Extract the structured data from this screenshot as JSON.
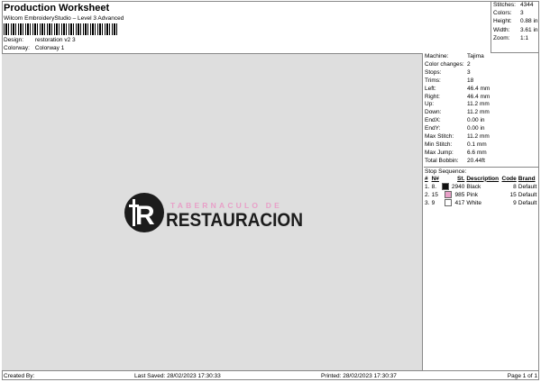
{
  "header": {
    "title": "Production Worksheet",
    "subtitle": "Wilcom EmbroideryStudio – Level 3 Advanced"
  },
  "design": {
    "label": "Design:",
    "value": "restoration v2 3"
  },
  "colorway": {
    "label": "Colorway:",
    "value": "Colorway 1"
  },
  "summary": [
    {
      "k": "Stitches:",
      "v": "4344"
    },
    {
      "k": "Colors:",
      "v": "3"
    },
    {
      "k": "Height:",
      "v": "0.88 in"
    },
    {
      "k": "Width:",
      "v": "3.61 in"
    },
    {
      "k": "Zoom:",
      "v": "1:1"
    }
  ],
  "details": [
    {
      "k": "Machine:",
      "v": "Tajima"
    },
    {
      "k": "Color changes:",
      "v": "2"
    },
    {
      "k": "Stops:",
      "v": "3"
    },
    {
      "k": "Trims:",
      "v": "18"
    },
    {
      "k": "Left:",
      "v": "46.4 mm"
    },
    {
      "k": "Right:",
      "v": "46.4 mm"
    },
    {
      "k": "Up:",
      "v": "11.2 mm"
    },
    {
      "k": "Down:",
      "v": "11.2 mm"
    },
    {
      "k": "EndX:",
      "v": "0.00 in"
    },
    {
      "k": "EndY:",
      "v": "0.00 in"
    },
    {
      "k": "Max Stitch:",
      "v": "11.2 mm"
    },
    {
      "k": "Min Stitch:",
      "v": "0.1 mm"
    },
    {
      "k": "Max Jump:",
      "v": "6.6 mm"
    },
    {
      "k": "Total Bobbin:",
      "v": "20.44ft"
    }
  ],
  "stop_sequence": {
    "title": "Stop Sequence:",
    "headers": [
      "#",
      "N#",
      "St.",
      "Description",
      "Code",
      "Brand"
    ],
    "rows": [
      {
        "n": "1.",
        "needle": "8.",
        "color": "#111111",
        "st": "2940",
        "desc": "Black",
        "code": "8",
        "brand": "Default"
      },
      {
        "n": "2.",
        "needle": "15",
        "color": "#e8a0c8",
        "st": "985",
        "desc": "Pink",
        "code": "15",
        "brand": "Default"
      },
      {
        "n": "3.",
        "needle": "9",
        "color": "#ffffff",
        "st": "417",
        "desc": "White",
        "code": "9",
        "brand": "Default"
      }
    ]
  },
  "logo": {
    "top_text": "TABERNACULO DE",
    "main_text": "RESTAURACION",
    "mark_text": "R",
    "pink": "#e8a0c8",
    "dark": "#1c1c1c"
  },
  "footer": {
    "created": "Created By:",
    "last_saved": "Last Saved: 28/02/2023 17:30:33",
    "printed": "Printed: 28/02/2023 17:30:37",
    "page": "Page 1 of 1"
  }
}
